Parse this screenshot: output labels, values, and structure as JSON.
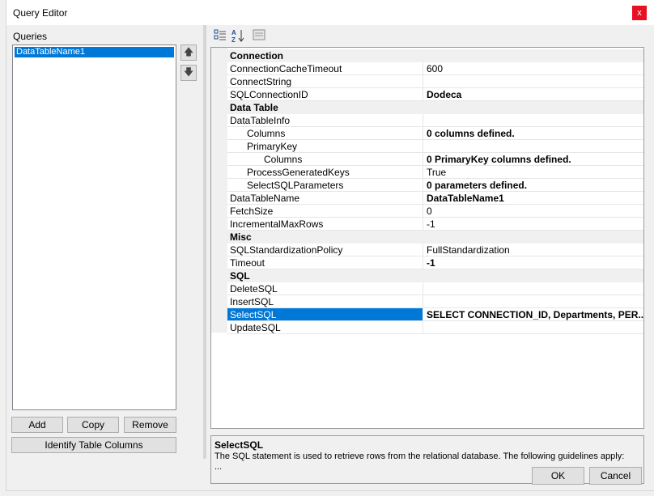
{
  "window": {
    "title": "Query Editor",
    "close_glyph": "x"
  },
  "queries": {
    "label": "Queries",
    "items": [
      "DataTableName1"
    ],
    "move_up_icon": "arrow-up-icon",
    "move_down_icon": "arrow-down-icon"
  },
  "buttons": {
    "add": "Add",
    "copy": "Copy",
    "remove": "Remove",
    "identify": "Identify Table Columns",
    "ok": "OK",
    "cancel": "Cancel"
  },
  "toolbar": {
    "categorized_icon": "categorized-icon",
    "alphabetical_icon": "alphabetical-sort-icon",
    "property_pages_icon": "property-pages-icon"
  },
  "properties": [
    {
      "name": "Connection",
      "value": "",
      "category": true
    },
    {
      "name": "ConnectionCacheTimeout",
      "value": "600",
      "indent": 0
    },
    {
      "name": "ConnectString",
      "value": "",
      "indent": 0
    },
    {
      "name": "SQLConnectionID",
      "value": "Dodeca",
      "indent": 0,
      "bold": true
    },
    {
      "name": "Data Table",
      "value": "",
      "category": true
    },
    {
      "name": "DataTableInfo",
      "value": "",
      "indent": 0
    },
    {
      "name": "Columns",
      "value": "0 columns defined.",
      "indent": 1,
      "bold": true
    },
    {
      "name": "PrimaryKey",
      "value": "",
      "indent": 1
    },
    {
      "name": "Columns",
      "value": "0 PrimaryKey columns defined.",
      "indent": 2,
      "bold": true
    },
    {
      "name": "ProcessGeneratedKeys",
      "value": "True",
      "indent": 1
    },
    {
      "name": "SelectSQLParameters",
      "value": "0 parameters defined.",
      "indent": 1,
      "bold": true
    },
    {
      "name": "DataTableName",
      "value": "DataTableName1",
      "indent": 0,
      "bold": true
    },
    {
      "name": "FetchSize",
      "value": "0",
      "indent": 0
    },
    {
      "name": "IncrementalMaxRows",
      "value": "-1",
      "indent": 0
    },
    {
      "name": "Misc",
      "value": "",
      "category": true
    },
    {
      "name": "SQLStandardizationPolicy",
      "value": "FullStandardization",
      "indent": 0
    },
    {
      "name": "Timeout",
      "value": "-1",
      "indent": 0,
      "bold": true
    },
    {
      "name": "SQL",
      "value": "",
      "category": true
    },
    {
      "name": "DeleteSQL",
      "value": "",
      "indent": 0
    },
    {
      "name": "InsertSQL",
      "value": "",
      "indent": 0
    },
    {
      "name": "SelectSQL",
      "value": "SELECT CONNECTION_ID, Departments, PER...",
      "indent": 0,
      "bold": true,
      "selected": true
    },
    {
      "name": "UpdateSQL",
      "value": "",
      "indent": 0
    }
  ],
  "help": {
    "title": "SelectSQL",
    "text": "The SQL statement is used to retrieve rows from the relational database.  The following guidelines apply:",
    "more": "..."
  },
  "colors": {
    "selection": "#0078d7",
    "close": "#e81123"
  }
}
